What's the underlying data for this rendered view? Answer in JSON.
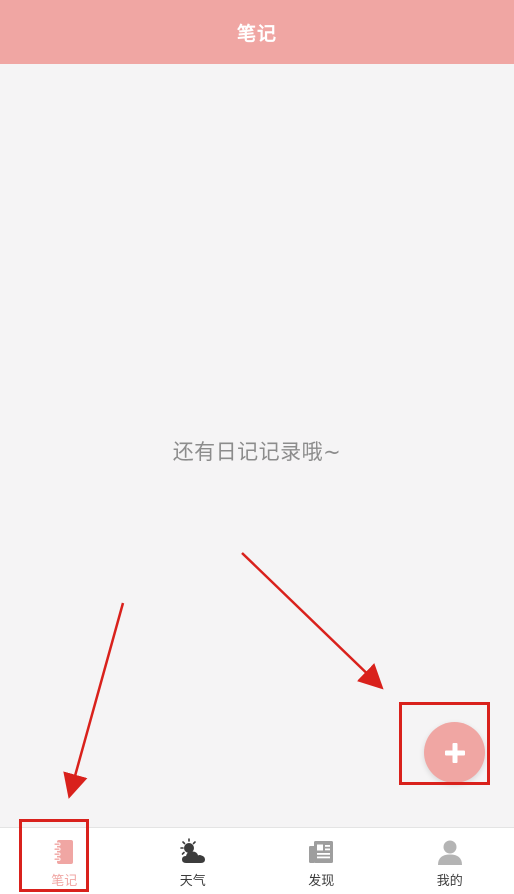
{
  "header": {
    "title": "笔记"
  },
  "empty_state": {
    "message": "还有日记记录哦~"
  },
  "fab": {
    "icon": "plus-icon"
  },
  "tabbar": {
    "items": [
      {
        "label": "笔记",
        "icon": "notebook-icon",
        "active": true
      },
      {
        "label": "天气",
        "icon": "weather-icon",
        "active": false
      },
      {
        "label": "发现",
        "icon": "newspaper-icon",
        "active": false
      },
      {
        "label": "我的",
        "icon": "user-icon",
        "active": false
      }
    ]
  },
  "colors": {
    "accent": "#f0a6a3",
    "background": "#f5f4f5",
    "annotation": "#d9211c",
    "text_muted": "#8c8c8c",
    "tab_inactive": "#3c3c3c"
  }
}
